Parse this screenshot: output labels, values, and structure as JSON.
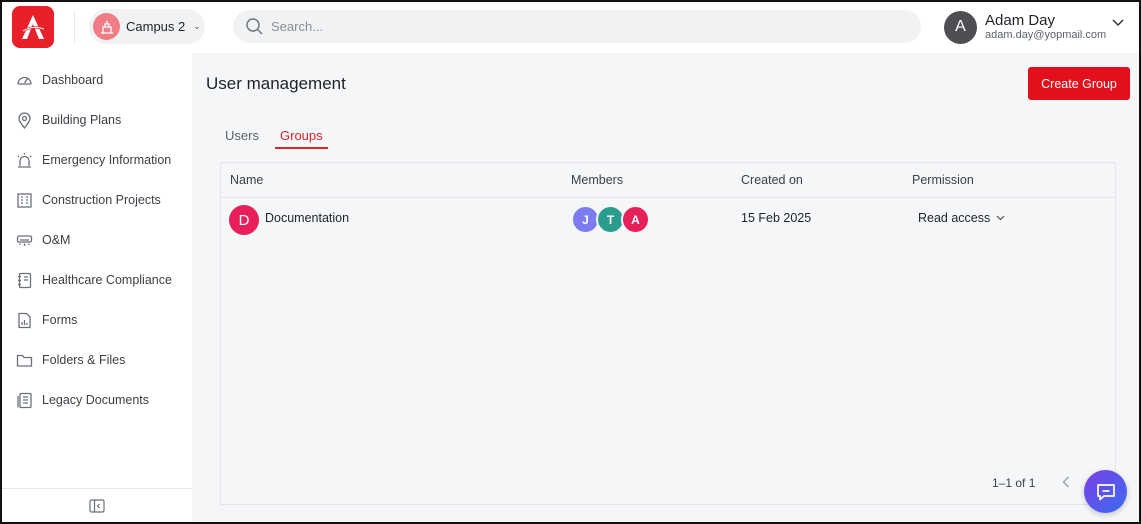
{
  "header": {
    "campus_label": "Campus 2",
    "search_placeholder": "Search...",
    "user_initial": "A",
    "user_name": "Adam Day",
    "user_email": "adam.day@yopmail.com"
  },
  "sidebar": {
    "items": [
      {
        "label": "Dashboard",
        "icon": "dashboard-icon"
      },
      {
        "label": "Building Plans",
        "icon": "location-pin-icon"
      },
      {
        "label": "Emergency Information",
        "icon": "siren-icon"
      },
      {
        "label": "Construction Projects",
        "icon": "building-icon"
      },
      {
        "label": "O&M",
        "icon": "hvac-icon"
      },
      {
        "label": "Healthcare Compliance",
        "icon": "notebook-icon"
      },
      {
        "label": "Forms",
        "icon": "form-icon"
      },
      {
        "label": "Folders & Files",
        "icon": "folder-icon"
      },
      {
        "label": "Legacy Documents",
        "icon": "documents-icon"
      }
    ]
  },
  "main": {
    "title": "User management",
    "create_button": "Create Group",
    "tabs": [
      {
        "label": "Users",
        "active": false
      },
      {
        "label": "Groups",
        "active": true
      }
    ],
    "table": {
      "headers": [
        "Name",
        "Members",
        "Created on",
        "Permission"
      ],
      "rows": [
        {
          "avatar_initial": "D",
          "name": "Documentation",
          "members": [
            {
              "initial": "J",
              "color": "#7b7cf0"
            },
            {
              "initial": "T",
              "color": "#2a9d8f"
            },
            {
              "initial": "A",
              "color": "#e8205a"
            }
          ],
          "created_on": "15 Feb 2025",
          "permission": "Read access"
        }
      ]
    },
    "pagination": "1–1 of 1"
  },
  "colors": {
    "brand_red": "#e30f1c",
    "tab_active": "#d9232d"
  }
}
